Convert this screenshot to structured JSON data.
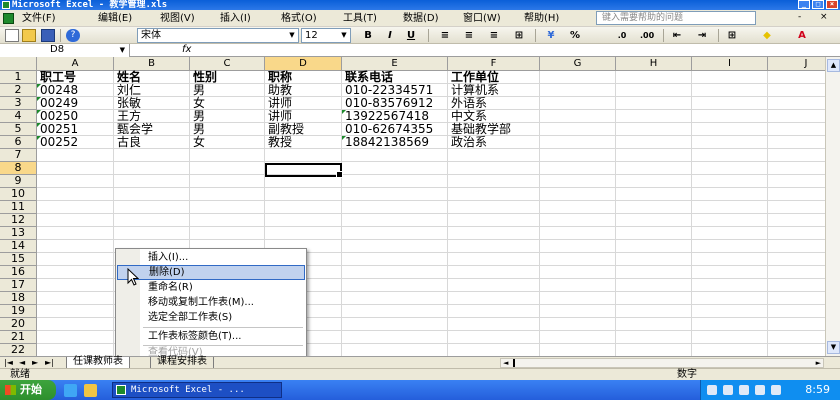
{
  "window": {
    "title": "Microsoft Excel - 教学管理.xls",
    "buttons": [
      "_",
      "□",
      "×"
    ]
  },
  "menubar": {
    "items": [
      "文件(F)",
      "编辑(E)",
      "视图(V)",
      "插入(I)",
      "格式(O)",
      "工具(T)",
      "数据(D)",
      "窗口(W)",
      "帮助(H)"
    ],
    "help_placeholder": "键入需要帮助的问题",
    "window_controls": [
      "-",
      "×"
    ]
  },
  "toolbar": {
    "font": "宋体",
    "size": "12",
    "bold": "B",
    "italic": "I",
    "underline": "U",
    "percent": "%"
  },
  "formula_bar": {
    "name_box": "D8",
    "fx": "fx",
    "content": ""
  },
  "columns": [
    "A",
    "B",
    "C",
    "D",
    "E",
    "F",
    "G",
    "H",
    "I",
    "J"
  ],
  "rows": [
    "1",
    "2",
    "3",
    "4",
    "5",
    "6",
    "7",
    "8",
    "9",
    "10",
    "11",
    "12",
    "13",
    "14",
    "15",
    "16",
    "17",
    "18",
    "19",
    "20",
    "21",
    "22"
  ],
  "table": {
    "headers": [
      "职工号",
      "姓名",
      "性别",
      "职称",
      "联系电话",
      "工作单位"
    ],
    "rows": [
      [
        "00248",
        "刘仁",
        "男",
        "助教",
        "010-22334571",
        "计算机系"
      ],
      [
        "00249",
        "张敏",
        "女",
        "讲师",
        "010-83576912",
        "外语系"
      ],
      [
        "00250",
        "王方",
        "男",
        "讲师",
        "13922567418",
        "中文系"
      ],
      [
        "00251",
        "甄会学",
        "男",
        "副教授",
        "010-62674355",
        "基础教学部"
      ],
      [
        "00252",
        "古良",
        "女",
        "教授",
        "18842138569",
        "政治系"
      ]
    ]
  },
  "context_menu": {
    "items": [
      "插入(I)...",
      "删除(D)",
      "重命名(R)",
      "移动或复制工作表(M)...",
      "选定全部工作表(S)",
      "工作表标签颜色(T)...",
      "查看代码(V)"
    ],
    "highlighted": "删除(D)",
    "disabled": "查看代码(V)"
  },
  "sheet_tabs": [
    "任课教师表",
    "课程安排表"
  ],
  "status": {
    "left": "就绪",
    "right": "数字"
  },
  "taskbar": {
    "start": "开始",
    "task": "Microsoft Excel - ...",
    "clock": "8:59"
  }
}
